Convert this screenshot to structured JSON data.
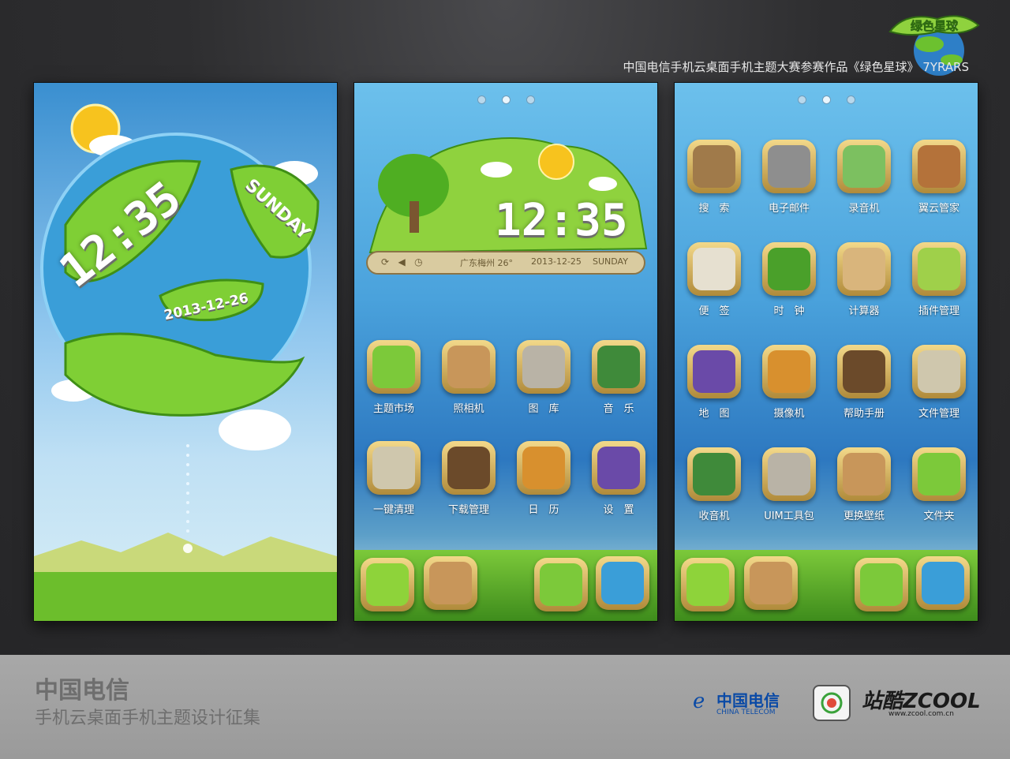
{
  "header": {
    "contest_title": "中国电信手机云桌面手机主题大赛参赛作品《绿色星球》   7YRARS",
    "logo_text": "绿色星球"
  },
  "lockscreen": {
    "time": "12:35",
    "day": "SUNDAY",
    "date": "2013-12-26"
  },
  "home": {
    "widget": {
      "time": "12:35",
      "location": "广东梅州 26°",
      "date": "2013-12-25",
      "day": "SUNDAY"
    },
    "apps": [
      "主题市场",
      "照相机",
      "图　库",
      "音　乐",
      "一键清理",
      "下载管理",
      "日　历",
      "设　置"
    ]
  },
  "drawer": {
    "apps": [
      "搜　索",
      "电子邮件",
      "录音机",
      "翼云管家",
      "便　签",
      "时　钟",
      "计算器",
      "插件管理",
      "地　图",
      "摄像机",
      "帮助手册",
      "文件管理",
      "收音机",
      "UIM工具包",
      "更换壁纸",
      "文件夹"
    ]
  },
  "footer": {
    "brand": "中国电信",
    "subtitle": "手机云桌面手机主题设计征集",
    "telecom_cn": "中国电信",
    "telecom_en": "CHINA TELECOM",
    "zcool": "站酷ZCOOL",
    "zcool_url": "www.zcool.com.cn"
  },
  "colors": {
    "frame_gold": "#c9a24e",
    "grass_green": "#6cc12f",
    "sky_blue": "#3a8fd0"
  }
}
